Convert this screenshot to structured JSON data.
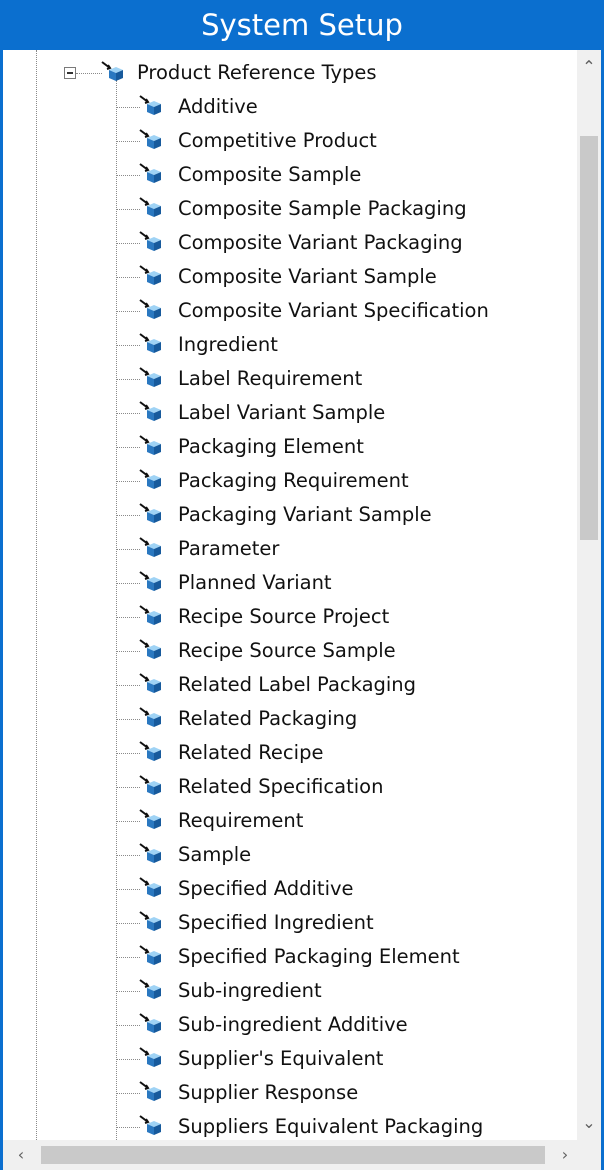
{
  "window": {
    "title": "System Setup",
    "accent_color": "#0b6fcf"
  },
  "tree": {
    "parent": {
      "label": "Product Reference Types",
      "icon": "reference-type-icon",
      "expanded": true
    },
    "children": [
      {
        "label": "Additive"
      },
      {
        "label": "Competitive Product"
      },
      {
        "label": "Composite Sample"
      },
      {
        "label": "Composite Sample Packaging"
      },
      {
        "label": "Composite Variant Packaging"
      },
      {
        "label": "Composite Variant Sample"
      },
      {
        "label": "Composite Variant Specification"
      },
      {
        "label": "Ingredient"
      },
      {
        "label": "Label Requirement"
      },
      {
        "label": "Label Variant Sample"
      },
      {
        "label": "Packaging Element"
      },
      {
        "label": "Packaging Requirement"
      },
      {
        "label": "Packaging Variant Sample"
      },
      {
        "label": "Parameter"
      },
      {
        "label": "Planned Variant"
      },
      {
        "label": "Recipe Source Project"
      },
      {
        "label": "Recipe Source Sample"
      },
      {
        "label": "Related Label Packaging"
      },
      {
        "label": "Related Packaging"
      },
      {
        "label": "Related Recipe"
      },
      {
        "label": "Related Specification"
      },
      {
        "label": "Requirement"
      },
      {
        "label": "Sample"
      },
      {
        "label": "Specified Additive"
      },
      {
        "label": "Specified Ingredient"
      },
      {
        "label": "Specified Packaging Element"
      },
      {
        "label": "Sub-ingredient"
      },
      {
        "label": "Sub-ingredient Additive"
      },
      {
        "label": "Supplier's Equivalent"
      },
      {
        "label": "Supplier Response"
      },
      {
        "label": "Suppliers Equivalent Packaging"
      }
    ]
  },
  "scrollbars": {
    "vertical": {
      "up_icon": "chevron-up-icon",
      "down_icon": "chevron-down-icon",
      "position_fraction": 0.0
    },
    "horizontal": {
      "left_icon": "chevron-left-icon",
      "right_icon": "chevron-right-icon",
      "position_fraction": 0.0
    }
  }
}
